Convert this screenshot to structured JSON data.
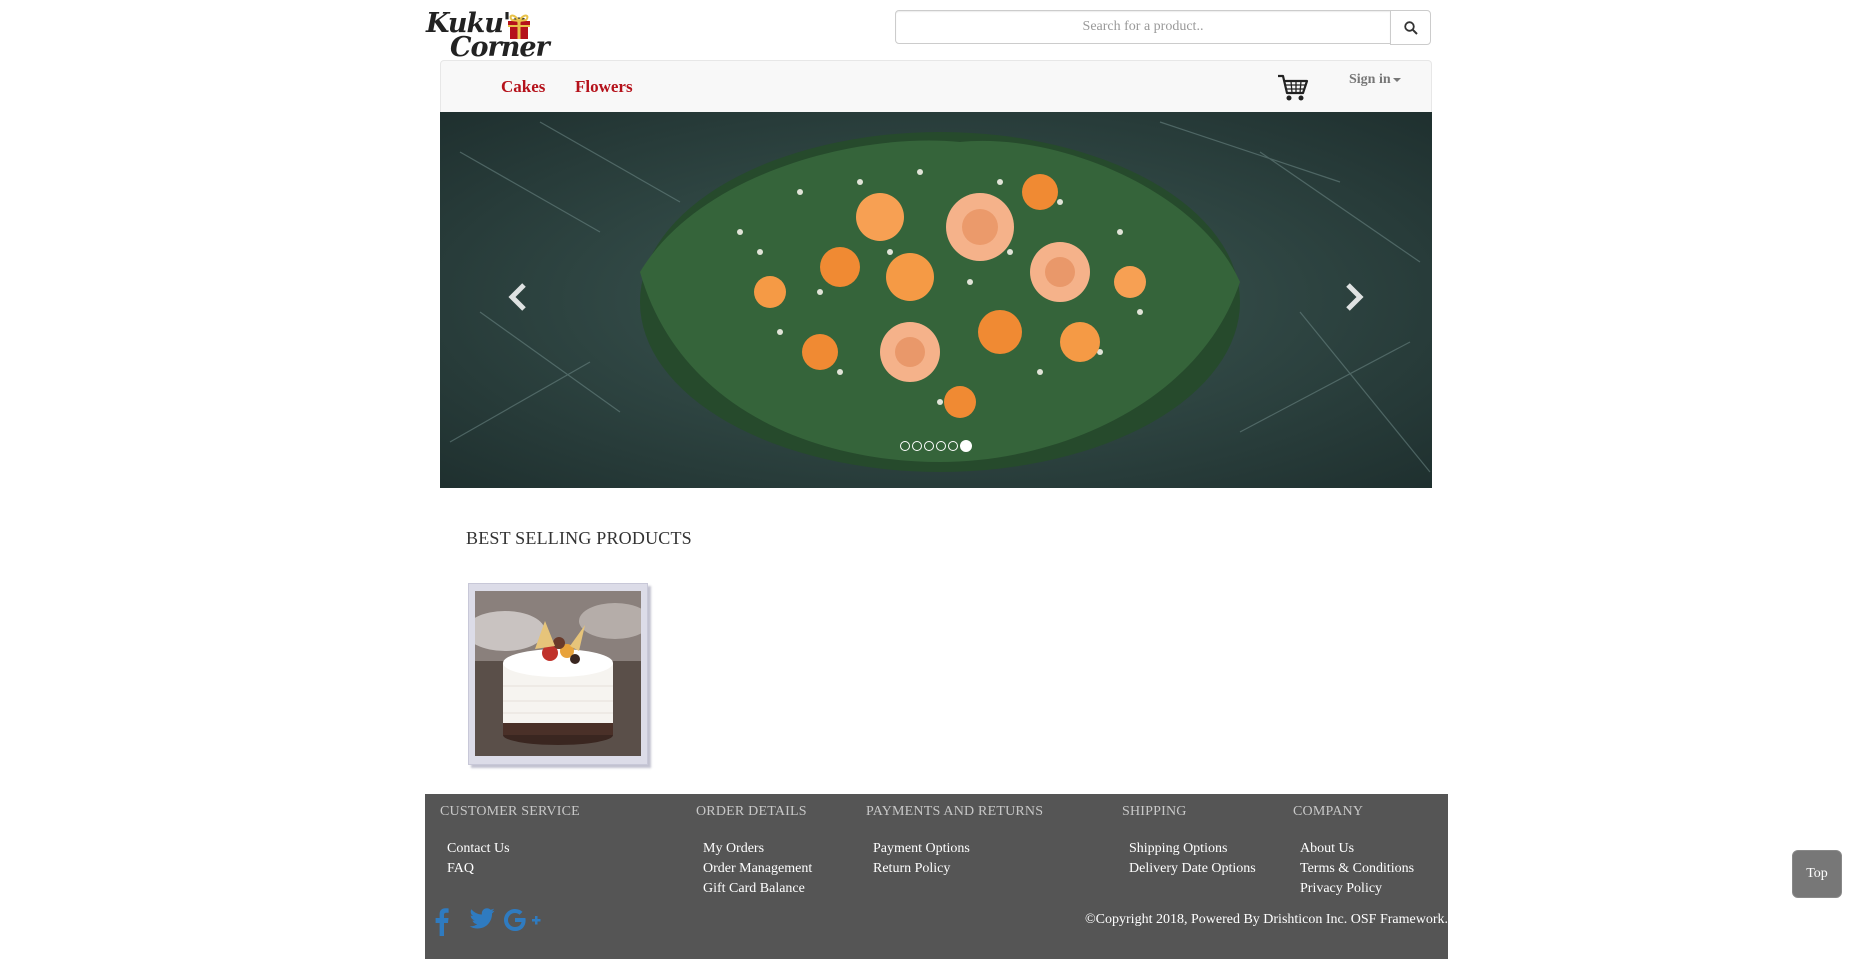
{
  "brand": {
    "name_line1": "Kuku's",
    "name_line2": "Corner",
    "gift_color": "#b5121b"
  },
  "search": {
    "placeholder": "Search for a product..",
    "value": ""
  },
  "nav": {
    "items": [
      {
        "label": "Cakes"
      },
      {
        "label": "Flowers"
      }
    ],
    "signin_label": "Sign in",
    "accent": "#b5121b"
  },
  "carousel": {
    "slides": 6,
    "active": 6,
    "subject": "orange roses bouquet"
  },
  "best_selling": {
    "title": "BEST SELLING PRODUCTS",
    "products": [
      {
        "subject": "white cake with fruit topping"
      }
    ]
  },
  "footer": {
    "columns": [
      {
        "heading": "CUSTOMER SERVICE",
        "links": [
          "Contact Us",
          "FAQ"
        ]
      },
      {
        "heading": "ORDER DETAILS",
        "links": [
          "My Orders",
          "Order Management",
          "Gift Card Balance"
        ]
      },
      {
        "heading": "PAYMENTS AND RETURNS",
        "links": [
          "Payment Options",
          "Return Policy"
        ]
      },
      {
        "heading": "SHIPPING",
        "links": [
          "Shipping Options",
          "Delivery Date Options"
        ]
      },
      {
        "heading": "COMPANY",
        "links": [
          "About Us",
          "Terms & Conditions",
          "Privacy Policy"
        ]
      }
    ],
    "social": [
      "facebook-icon",
      "twitter-icon",
      "google-plus-icon"
    ],
    "copyright": "©Copyright 2018, Powered By Drishticon Inc. OSF Framework."
  },
  "top_button": "Top"
}
